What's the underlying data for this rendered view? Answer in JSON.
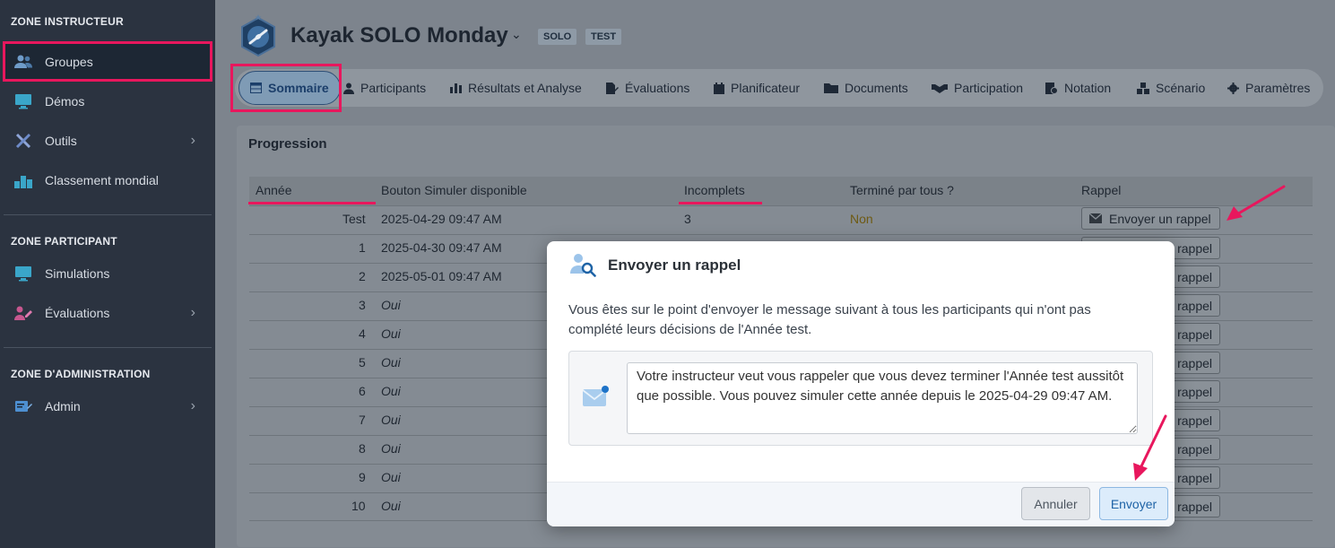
{
  "sidebar": {
    "zone_instructor": "ZONE INSTRUCTEUR",
    "zone_participant": "ZONE PARTICIPANT",
    "zone_admin": "ZONE D'ADMINISTRATION",
    "items": [
      {
        "label": "Groupes",
        "icon": "users-icon"
      },
      {
        "label": "Démos",
        "icon": "monitor-icon"
      },
      {
        "label": "Outils",
        "icon": "tools-icon"
      },
      {
        "label": "Classement mondial",
        "icon": "podium-icon"
      },
      {
        "label": "Simulations",
        "icon": "monitor-icon"
      },
      {
        "label": "Évaluations",
        "icon": "evaluation-icon"
      },
      {
        "label": "Admin",
        "icon": "admin-icon"
      }
    ]
  },
  "header": {
    "title": "Kayak SOLO Monday",
    "tags": [
      "SOLO",
      "TEST"
    ]
  },
  "tabs": [
    {
      "label": "Sommaire",
      "icon": "table-icon"
    },
    {
      "label": "Participants",
      "icon": "user-icon"
    },
    {
      "label": "Résultats et Analyse",
      "icon": "bar-chart-icon"
    },
    {
      "label": "Évaluations",
      "icon": "edit-file-icon"
    },
    {
      "label": "Planificateur",
      "icon": "calendar-icon"
    },
    {
      "label": "Documents",
      "icon": "folder-icon"
    },
    {
      "label": "Participation",
      "icon": "handshake-icon"
    },
    {
      "label": "Notation",
      "icon": "grading-icon"
    },
    {
      "label": "Scénario",
      "icon": "boxes-icon"
    },
    {
      "label": "Paramètres",
      "icon": "gear-icon"
    }
  ],
  "progression": {
    "title": "Progression",
    "columns": [
      "Année",
      "Bouton Simuler disponible",
      "Incomplets",
      "Terminé par tous ?",
      "Rappel"
    ],
    "rows": [
      {
        "year": "Test",
        "date": "2025-04-29 09:47 AM",
        "incomplete": "3",
        "done": "Non",
        "btn": "Envoyer un rappel"
      },
      {
        "year": "1",
        "date": "2025-04-30 09:47 AM",
        "incomplete": "",
        "done": "",
        "btn": "rappel"
      },
      {
        "year": "2",
        "date": "2025-05-01 09:47 AM",
        "incomplete": "",
        "done": "",
        "btn": "rappel"
      },
      {
        "year": "3",
        "date": "Oui",
        "incomplete": "",
        "done": "",
        "btn": "rappel"
      },
      {
        "year": "4",
        "date": "Oui",
        "incomplete": "",
        "done": "",
        "btn": "rappel"
      },
      {
        "year": "5",
        "date": "Oui",
        "incomplete": "",
        "done": "",
        "btn": "rappel"
      },
      {
        "year": "6",
        "date": "Oui",
        "incomplete": "",
        "done": "",
        "btn": "rappel"
      },
      {
        "year": "7",
        "date": "Oui",
        "incomplete": "",
        "done": "",
        "btn": "rappel"
      },
      {
        "year": "8",
        "date": "Oui",
        "incomplete": "",
        "done": "",
        "btn": "rappel"
      },
      {
        "year": "9",
        "date": "Oui",
        "incomplete": "",
        "done": "",
        "btn": "rappel"
      },
      {
        "year": "10",
        "date": "Oui",
        "incomplete": "",
        "done": "",
        "btn": "rappel"
      }
    ]
  },
  "modal": {
    "title": "Envoyer un rappel",
    "message": "Vous êtes sur le point d'envoyer le message suivant à tous les participants qui n'ont pas complété leurs décisions de l'Année test.",
    "textarea_value": "Votre instructeur veut vous rappeler que vous devez terminer l'Année test aussitôt que possible. Vous pouvez simuler cette année depuis le 2025-04-29 09:47 AM.",
    "cancel_label": "Annuler",
    "send_label": "Envoyer"
  },
  "colors": {
    "annotation": "#e8175d",
    "sidebar_bg": "#2b3340",
    "primary": "#1e63a6"
  }
}
